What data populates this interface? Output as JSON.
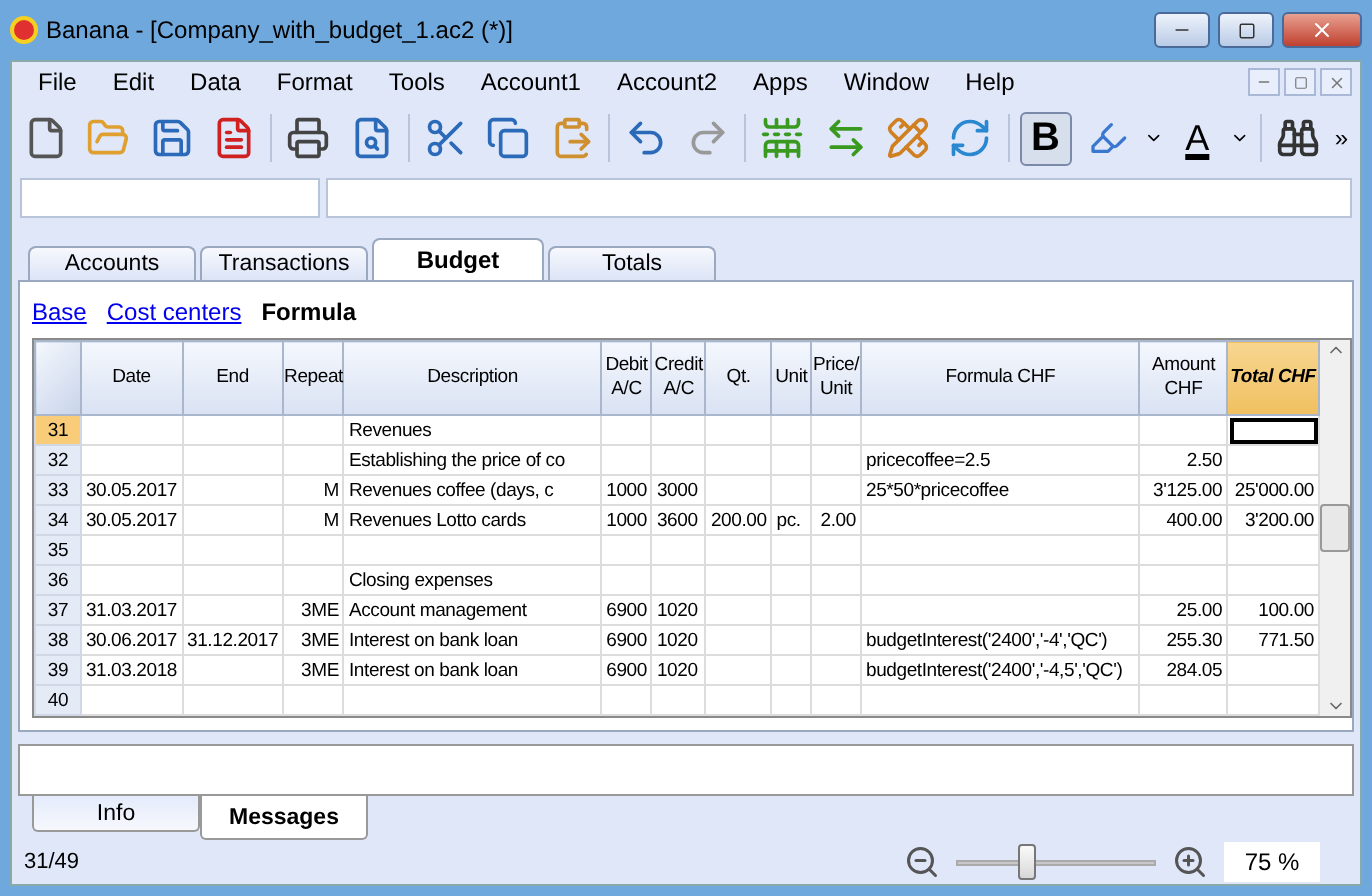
{
  "window": {
    "title": "Banana - [Company_with_budget_1.ac2 (*)]"
  },
  "menu": [
    "File",
    "Edit",
    "Data",
    "Format",
    "Tools",
    "Account1",
    "Account2",
    "Apps",
    "Window",
    "Help"
  ],
  "toolbar": {
    "overflow": "»",
    "bold": "B",
    "font_color": "A"
  },
  "tabs": [
    {
      "label": "Accounts",
      "selected": false
    },
    {
      "label": "Transactions",
      "selected": false
    },
    {
      "label": "Budget",
      "selected": true
    },
    {
      "label": "Totals",
      "selected": false
    }
  ],
  "views": [
    {
      "label": "Base",
      "selected": false
    },
    {
      "label": "Cost centers",
      "selected": false
    },
    {
      "label": "Formula",
      "selected": true
    }
  ],
  "table": {
    "columns": [
      {
        "label": "Date",
        "selected": false
      },
      {
        "label": "End",
        "selected": false
      },
      {
        "label": "Repeat",
        "selected": false
      },
      {
        "label": "Description",
        "selected": false
      },
      {
        "label": "Debit\nA/C",
        "selected": false
      },
      {
        "label": "Credit\nA/C",
        "selected": false
      },
      {
        "label": "Qt.",
        "selected": false
      },
      {
        "label": "Unit",
        "selected": false
      },
      {
        "label": "Price/\nUnit",
        "selected": false
      },
      {
        "label": "Formula CHF",
        "selected": false
      },
      {
        "label": "Amount\nCHF",
        "selected": false
      },
      {
        "label": "Total CHF",
        "selected": true
      }
    ],
    "rows": [
      {
        "number": "31",
        "selected": true,
        "cells": [
          "",
          "",
          "",
          "Revenues",
          "",
          "",
          "",
          "",
          "",
          "",
          "",
          ""
        ]
      },
      {
        "number": "32",
        "selected": false,
        "cells": [
          "",
          "",
          "",
          "Establishing the price of co",
          "",
          "",
          "",
          "",
          "",
          "pricecoffee=2.5",
          "2.50",
          ""
        ]
      },
      {
        "number": "33",
        "selected": false,
        "cells": [
          "30.05.2017",
          "",
          "M",
          "Revenues coffee (days, c",
          "1000",
          "3000",
          "",
          "",
          "",
          "25*50*pricecoffee",
          "3'125.00",
          "25'000.00"
        ]
      },
      {
        "number": "34",
        "selected": false,
        "cells": [
          "30.05.2017",
          "",
          "M",
          "Revenues Lotto cards",
          "1000",
          "3600",
          "200.00",
          "pc.",
          "2.00",
          "",
          "400.00",
          "3'200.00"
        ]
      },
      {
        "number": "35",
        "selected": false,
        "cells": [
          "",
          "",
          "",
          "",
          "",
          "",
          "",
          "",
          "",
          "",
          "",
          ""
        ]
      },
      {
        "number": "36",
        "selected": false,
        "cells": [
          "",
          "",
          "",
          "Closing expenses",
          "",
          "",
          "",
          "",
          "",
          "",
          "",
          ""
        ]
      },
      {
        "number": "37",
        "selected": false,
        "cells": [
          "31.03.2017",
          "",
          "3ME",
          "Account management",
          "6900",
          "1020",
          "",
          "",
          "",
          "",
          "25.00",
          "100.00"
        ]
      },
      {
        "number": "38",
        "selected": false,
        "cells": [
          "30.06.2017",
          "31.12.2017",
          "3ME",
          "Interest on bank loan",
          "6900",
          "1020",
          "",
          "",
          "",
          "budgetInterest('2400','-4','QC')",
          "255.30",
          "771.50"
        ]
      },
      {
        "number": "39",
        "selected": false,
        "cells": [
          "31.03.2018",
          "",
          "3ME",
          "Interest on bank loan",
          "6900",
          "1020",
          "",
          "",
          "",
          "budgetInterest('2400','-4,5','QC')",
          "284.05",
          ""
        ]
      },
      {
        "number": "40",
        "selected": false,
        "cells": [
          "",
          "",
          "",
          "",
          "",
          "",
          "",
          "",
          "",
          "",
          "",
          ""
        ]
      }
    ]
  },
  "bottom_tabs": [
    {
      "label": "Info",
      "selected": false
    },
    {
      "label": "Messages",
      "selected": true
    }
  ],
  "status_bar": {
    "position": "31/49",
    "zoom": {
      "level": 0.36,
      "reading": "75 %"
    }
  }
}
